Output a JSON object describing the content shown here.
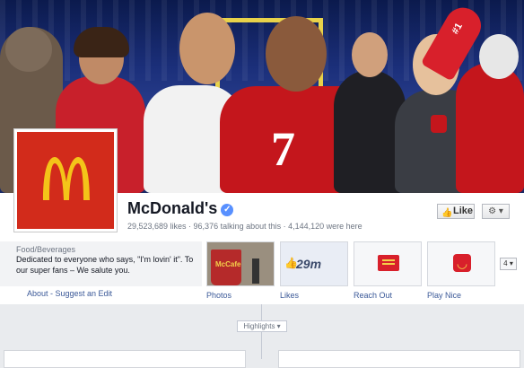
{
  "page": {
    "name": "McDonald's",
    "stats": "29,523,689 likes · 96,376 talking about this · 4,144,120 were here",
    "like_label": "Like",
    "gear_label": "⚙ ▾"
  },
  "cover": {
    "foam_finger_text": "#1"
  },
  "about": {
    "category": "Food/Beverages",
    "description": "Dedicated to everyone who says, \"I'm lovin' it\". To our super fans – We salute you.",
    "link": "About - Suggest an Edit"
  },
  "apps": [
    {
      "label": "Photos",
      "thumb_text": "McCafe"
    },
    {
      "label": "Likes",
      "thumb_text": "29m"
    },
    {
      "label": "Reach Out"
    },
    {
      "label": "Play Nice"
    }
  ],
  "more_apps": "4 ▾",
  "timeline": {
    "highlights_label": "Highlights ▾"
  },
  "colors": {
    "brand_red": "#d22b1b",
    "arches_yellow": "#f4c419",
    "facebook_blue": "#3b5998"
  }
}
